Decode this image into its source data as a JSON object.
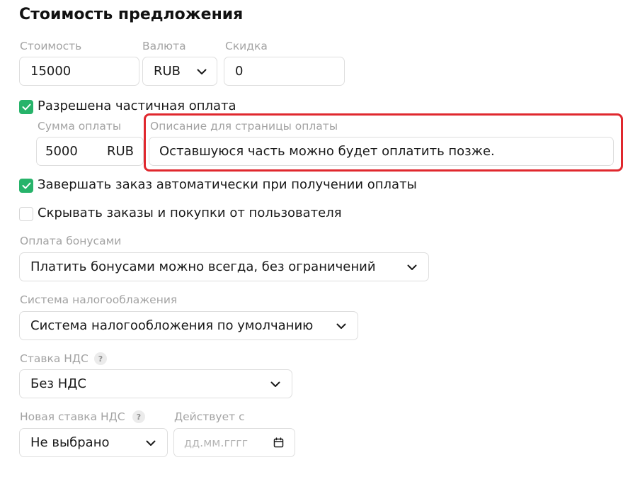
{
  "page": {
    "title": "Стоимость предложения"
  },
  "price": {
    "cost_label": "Стоимость",
    "cost_value": "15000",
    "currency_label": "Валюта",
    "currency_value": "RUB",
    "discount_label": "Скидка",
    "discount_value": "0"
  },
  "partial_payment": {
    "checkbox_label": "Разрешена частичная оплата",
    "checked": true,
    "amount_label": "Сумма оплаты",
    "amount_value": "5000",
    "amount_currency": "RUB",
    "description_label": "Описание для страницы оплаты",
    "description_value": "Оставшуюся часть можно будет оплатить позже."
  },
  "options": {
    "auto_complete_label": "Завершать заказ автоматически при получении оплаты",
    "auto_complete_checked": true,
    "hide_orders_label": "Скрывать заказы и покупки от пользователя",
    "hide_orders_checked": false
  },
  "bonus": {
    "label": "Оплата бонусами",
    "value": "Платить бонусами можно всегда, без ограничений"
  },
  "tax_system": {
    "label": "Система налогооблажения",
    "value": "Система налогообложения по умолчанию"
  },
  "vat": {
    "label": "Ставка НДС",
    "help": "?",
    "value": "Без НДС"
  },
  "new_vat": {
    "label": "Новая ставка НДС",
    "help": "?",
    "value": "Не выбрано",
    "effective_label": "Действует с",
    "date_placeholder": "дд.мм.гггг"
  },
  "colors": {
    "accent_green": "#27b36a",
    "highlight_red": "#e0282e"
  },
  "icons": {
    "check": "check-icon",
    "dropdown": "chevron-down-icon",
    "calendar": "calendar-icon",
    "help": "help-icon"
  }
}
